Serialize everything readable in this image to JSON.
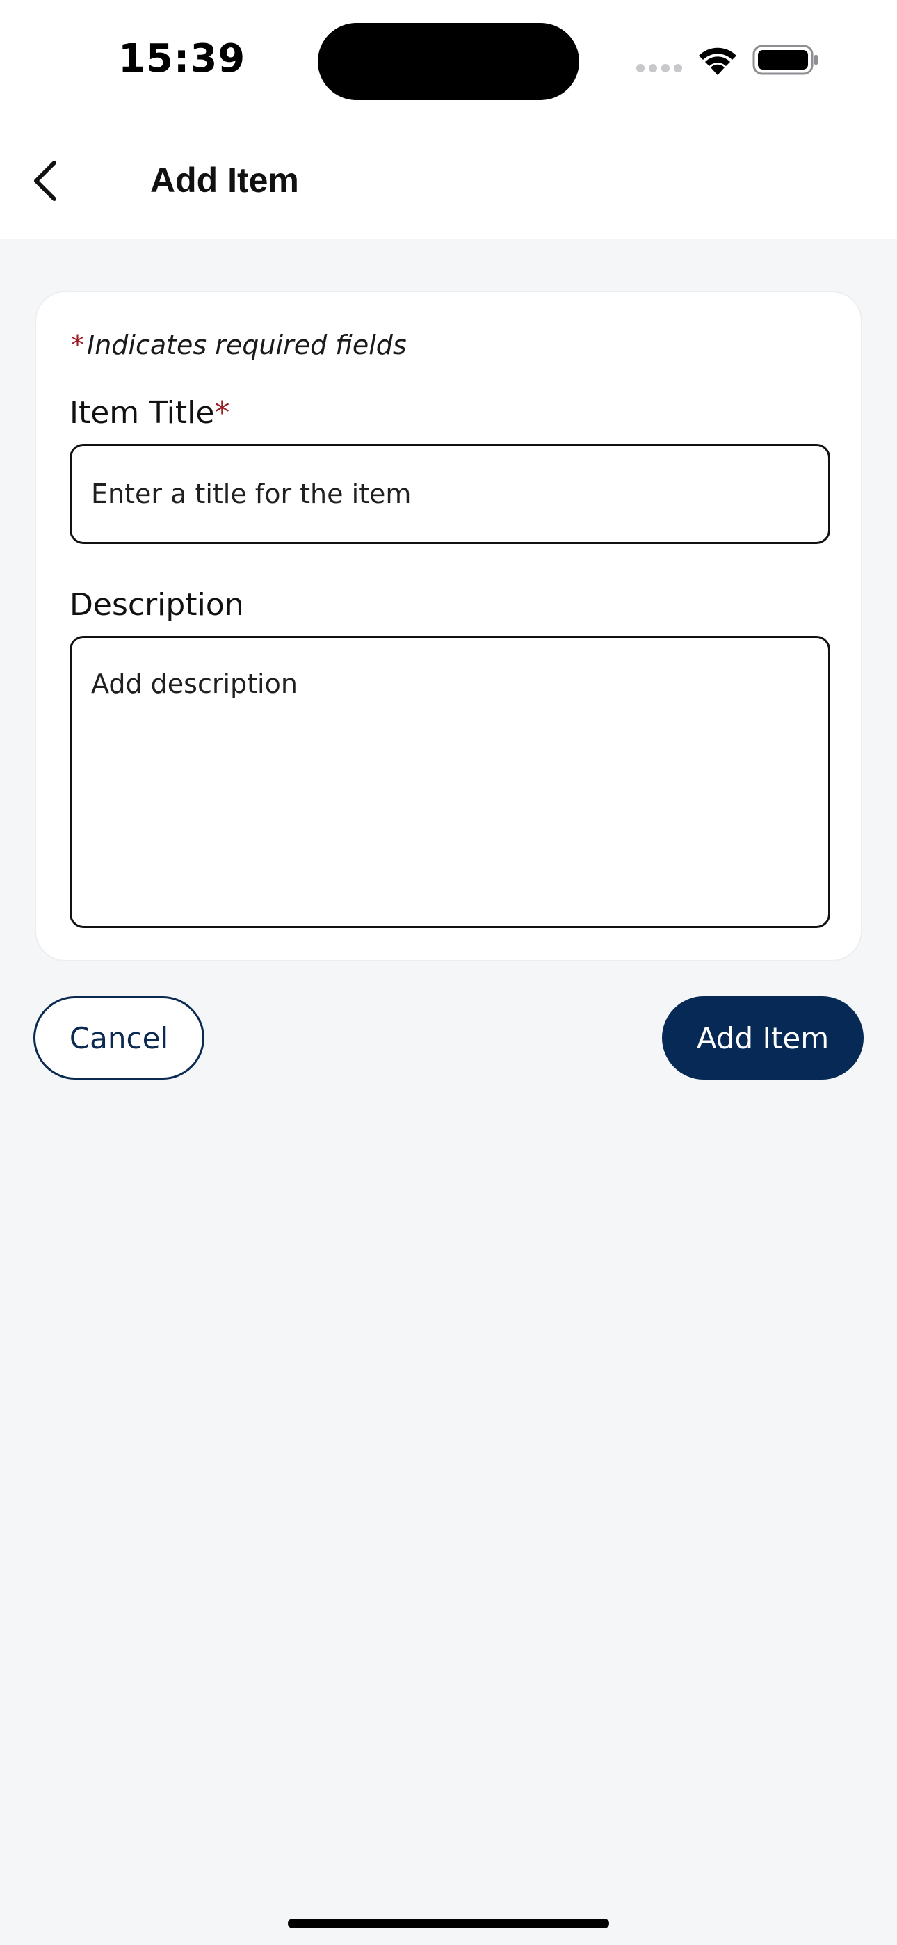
{
  "status_bar": {
    "time": "15:39",
    "icons": [
      "signal-icon",
      "wifi-icon",
      "battery-icon"
    ]
  },
  "header": {
    "back_icon": "chevron-left-icon",
    "title": "Add Item"
  },
  "form": {
    "required_note": {
      "asterisk": "*",
      "text": "Indicates required fields"
    },
    "item_title": {
      "label": "Item Title",
      "required_marker": "*",
      "value": "",
      "placeholder": "Enter a title for the item"
    },
    "description": {
      "label": "Description",
      "value": "",
      "placeholder": "Add description"
    }
  },
  "actions": {
    "cancel_label": "Cancel",
    "submit_label": "Add Item"
  },
  "colors": {
    "primary": "#062a55",
    "required": "#9b1c23",
    "background": "#f5f6f8"
  }
}
